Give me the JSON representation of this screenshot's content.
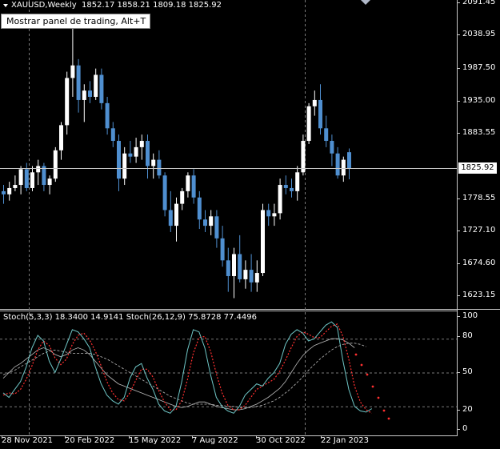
{
  "header": {
    "symbol": "XAUUSD,Weekly",
    "ohlc": "1852.17 1858.21 1809.18 1825.92",
    "collapse_icon": "triangle-down-icon"
  },
  "tooltip": {
    "text": "Mostrar panel de trading, Alt+T"
  },
  "current_price": "1825.92",
  "price_axis": [
    "2091.45",
    "2038.95",
    "1987.50",
    "1935.00",
    "1883.55",
    "1778.55",
    "1727.10",
    "1674.60",
    "1623.15"
  ],
  "stoch_header": "Stoch(5,3,3) 18.3400 14.9141  Stoch(26,12,9) 75.8728 77.4496",
  "stoch_axis": [
    "100",
    "80",
    "50",
    "20",
    "0"
  ],
  "time_axis": [
    "28 Nov 2021",
    "20 Feb 2022",
    "15 May 2022",
    "7 Aug 2022",
    "30 Oct 2022",
    "22 Jan 2023"
  ],
  "colors": {
    "bull": "#ffffff",
    "bear": "#4f8fd0",
    "main_stoch": "#6fc7c7",
    "signal": "#ff3030",
    "grid": "#7a7a7a"
  },
  "candles": [
    {
      "o": 1790,
      "h": 1800,
      "l": 1770,
      "c": 1785
    },
    {
      "o": 1785,
      "h": 1805,
      "l": 1775,
      "c": 1795
    },
    {
      "o": 1795,
      "h": 1815,
      "l": 1790,
      "c": 1800
    },
    {
      "o": 1800,
      "h": 1830,
      "l": 1785,
      "c": 1825
    },
    {
      "o": 1825,
      "h": 1835,
      "l": 1790,
      "c": 1795
    },
    {
      "o": 1795,
      "h": 1830,
      "l": 1790,
      "c": 1820
    },
    {
      "o": 1820,
      "h": 1840,
      "l": 1800,
      "c": 1830
    },
    {
      "o": 1830,
      "h": 1835,
      "l": 1790,
      "c": 1800
    },
    {
      "o": 1800,
      "h": 1815,
      "l": 1785,
      "c": 1810
    },
    {
      "o": 1810,
      "h": 1860,
      "l": 1805,
      "c": 1855
    },
    {
      "o": 1855,
      "h": 1900,
      "l": 1840,
      "c": 1895
    },
    {
      "o": 1895,
      "h": 1980,
      "l": 1880,
      "c": 1970
    },
    {
      "o": 1970,
      "h": 2070,
      "l": 1940,
      "c": 1990
    },
    {
      "o": 1990,
      "h": 2000,
      "l": 1915,
      "c": 1935
    },
    {
      "o": 1935,
      "h": 1960,
      "l": 1900,
      "c": 1950
    },
    {
      "o": 1950,
      "h": 1965,
      "l": 1930,
      "c": 1940
    },
    {
      "o": 1940,
      "h": 1985,
      "l": 1935,
      "c": 1975
    },
    {
      "o": 1975,
      "h": 1985,
      "l": 1920,
      "c": 1930
    },
    {
      "o": 1930,
      "h": 1940,
      "l": 1880,
      "c": 1890
    },
    {
      "o": 1890,
      "h": 1900,
      "l": 1860,
      "c": 1870
    },
    {
      "o": 1870,
      "h": 1880,
      "l": 1790,
      "c": 1810
    },
    {
      "o": 1810,
      "h": 1860,
      "l": 1800,
      "c": 1850
    },
    {
      "o": 1850,
      "h": 1870,
      "l": 1835,
      "c": 1845
    },
    {
      "o": 1845,
      "h": 1875,
      "l": 1835,
      "c": 1860
    },
    {
      "o": 1860,
      "h": 1880,
      "l": 1840,
      "c": 1870
    },
    {
      "o": 1870,
      "h": 1880,
      "l": 1810,
      "c": 1830
    },
    {
      "o": 1830,
      "h": 1850,
      "l": 1810,
      "c": 1840
    },
    {
      "o": 1840,
      "h": 1855,
      "l": 1810,
      "c": 1815
    },
    {
      "o": 1815,
      "h": 1820,
      "l": 1750,
      "c": 1760
    },
    {
      "o": 1760,
      "h": 1790,
      "l": 1725,
      "c": 1735
    },
    {
      "o": 1735,
      "h": 1780,
      "l": 1710,
      "c": 1770
    },
    {
      "o": 1770,
      "h": 1795,
      "l": 1760,
      "c": 1790
    },
    {
      "o": 1790,
      "h": 1820,
      "l": 1780,
      "c": 1815
    },
    {
      "o": 1815,
      "h": 1825,
      "l": 1770,
      "c": 1780
    },
    {
      "o": 1780,
      "h": 1790,
      "l": 1730,
      "c": 1745
    },
    {
      "o": 1745,
      "h": 1760,
      "l": 1725,
      "c": 1735
    },
    {
      "o": 1735,
      "h": 1760,
      "l": 1720,
      "c": 1750
    },
    {
      "o": 1750,
      "h": 1760,
      "l": 1700,
      "c": 1715
    },
    {
      "o": 1715,
      "h": 1735,
      "l": 1670,
      "c": 1680
    },
    {
      "o": 1680,
      "h": 1700,
      "l": 1630,
      "c": 1655
    },
    {
      "o": 1655,
      "h": 1700,
      "l": 1620,
      "c": 1690
    },
    {
      "o": 1690,
      "h": 1720,
      "l": 1645,
      "c": 1650
    },
    {
      "o": 1650,
      "h": 1680,
      "l": 1635,
      "c": 1665
    },
    {
      "o": 1665,
      "h": 1690,
      "l": 1630,
      "c": 1645
    },
    {
      "o": 1645,
      "h": 1680,
      "l": 1630,
      "c": 1660
    },
    {
      "o": 1660,
      "h": 1770,
      "l": 1655,
      "c": 1760
    },
    {
      "o": 1760,
      "h": 1770,
      "l": 1735,
      "c": 1750
    },
    {
      "o": 1750,
      "h": 1770,
      "l": 1735,
      "c": 1755
    },
    {
      "o": 1755,
      "h": 1810,
      "l": 1745,
      "c": 1800
    },
    {
      "o": 1800,
      "h": 1815,
      "l": 1785,
      "c": 1795
    },
    {
      "o": 1795,
      "h": 1810,
      "l": 1780,
      "c": 1790
    },
    {
      "o": 1790,
      "h": 1830,
      "l": 1775,
      "c": 1820
    },
    {
      "o": 1820,
      "h": 1880,
      "l": 1815,
      "c": 1870
    },
    {
      "o": 1870,
      "h": 1930,
      "l": 1865,
      "c": 1925
    },
    {
      "o": 1925,
      "h": 1950,
      "l": 1910,
      "c": 1935
    },
    {
      "o": 1935,
      "h": 1960,
      "l": 1880,
      "c": 1890
    },
    {
      "o": 1890,
      "h": 1910,
      "l": 1860,
      "c": 1870
    },
    {
      "o": 1870,
      "h": 1880,
      "l": 1830,
      "c": 1850
    },
    {
      "o": 1850,
      "h": 1860,
      "l": 1810,
      "c": 1815
    },
    {
      "o": 1815,
      "h": 1845,
      "l": 1805,
      "c": 1840
    },
    {
      "o": 1852,
      "h": 1858,
      "l": 1809,
      "c": 1826
    }
  ],
  "stoch_fast": [
    32,
    28,
    35,
    42,
    55,
    72,
    83,
    78,
    60,
    50,
    62,
    75,
    88,
    86,
    80,
    72,
    55,
    40,
    30,
    25,
    22,
    28,
    45,
    55,
    58,
    45,
    35,
    22,
    16,
    14,
    20,
    42,
    70,
    88,
    86,
    72,
    48,
    28,
    20,
    16,
    14,
    20,
    30,
    35,
    40,
    38,
    45,
    50,
    58,
    75,
    84,
    88,
    85,
    78,
    80,
    86,
    92,
    95,
    90,
    60,
    35,
    20,
    16,
    15,
    18
  ],
  "stoch_signal": [
    30,
    32,
    31,
    35,
    44,
    56,
    70,
    78,
    74,
    63,
    57,
    62,
    75,
    83,
    85,
    79,
    69,
    56,
    42,
    32,
    26,
    25,
    32,
    43,
    53,
    53,
    46,
    34,
    24,
    17,
    17,
    25,
    44,
    67,
    81,
    82,
    69,
    49,
    32,
    21,
    17,
    17,
    21,
    28,
    35,
    38,
    41,
    44,
    51,
    61,
    72,
    82,
    86,
    84,
    81,
    81,
    86,
    91,
    93,
    82,
    62,
    38,
    24,
    17,
    14
  ],
  "stoch_slow_main": [
    45,
    50,
    55,
    58,
    62,
    66,
    70,
    72,
    70,
    66,
    64,
    66,
    70,
    72,
    70,
    66,
    60,
    54,
    48,
    44,
    40,
    38,
    36,
    34,
    32,
    30,
    28,
    26,
    24,
    22,
    20,
    19,
    20,
    22,
    24,
    24,
    22,
    20,
    19,
    18,
    17,
    17,
    18,
    20,
    22,
    25,
    28,
    32,
    36,
    42,
    50,
    58,
    65,
    70,
    74,
    76,
    78,
    80,
    80,
    79,
    76,
    72
  ],
  "stoch_slow_signal": [
    48,
    50,
    52,
    55,
    58,
    61,
    64,
    67,
    69,
    70,
    69,
    68,
    67,
    67,
    67,
    67,
    66,
    64,
    62,
    59,
    56,
    53,
    50,
    47,
    44,
    41,
    38,
    35,
    32,
    29,
    27,
    25,
    23,
    22,
    22,
    22,
    22,
    21,
    21,
    20,
    20,
    19,
    19,
    19,
    20,
    21,
    23,
    25,
    28,
    32,
    36,
    41,
    46,
    52,
    57,
    62,
    66,
    70,
    73,
    75,
    76,
    76,
    75,
    73
  ]
}
